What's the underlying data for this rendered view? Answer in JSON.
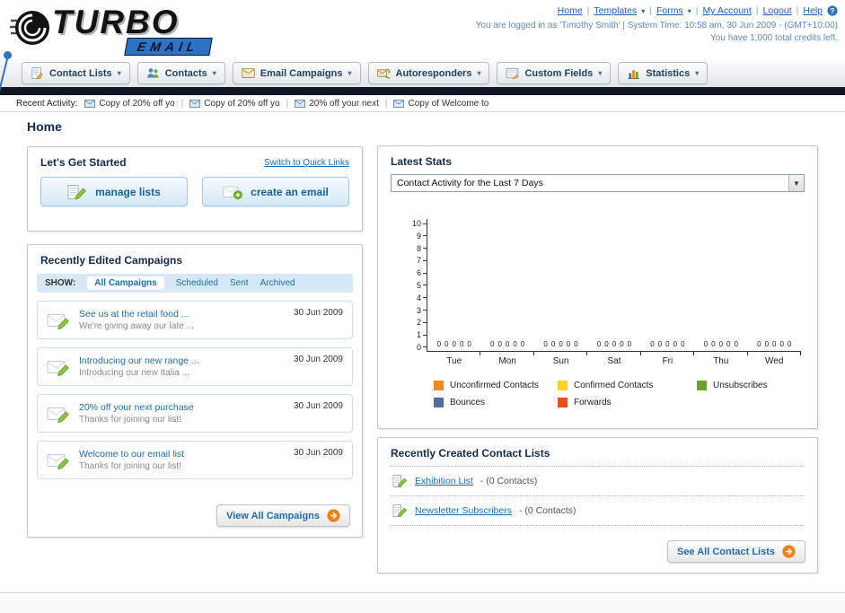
{
  "page_title": "Home",
  "header": {
    "logo_primary": "TURBO",
    "logo_secondary": "EMAIL",
    "nav_links": [
      {
        "label": "Home",
        "dropdown": false
      },
      {
        "label": "Templates",
        "dropdown": true
      },
      {
        "label": "Forms",
        "dropdown": true
      },
      {
        "label": "My Account",
        "dropdown": false
      },
      {
        "label": "Logout",
        "dropdown": false
      },
      {
        "label": "Help",
        "dropdown": false
      }
    ],
    "login_info": "You are logged in as 'Timothy Smith' | System Time: 10:58 am, 30 Jun 2009 - (GMT+10:00)",
    "credits": "You have 1,000 total credits left."
  },
  "nav": {
    "tabs": [
      {
        "label": "Contact Lists",
        "icon": "contact-lists-icon"
      },
      {
        "label": "Contacts",
        "icon": "contacts-icon"
      },
      {
        "label": "Email Campaigns",
        "icon": "email-campaigns-icon"
      },
      {
        "label": "Autoresponders",
        "icon": "autoresponders-icon"
      },
      {
        "label": "Custom Fields",
        "icon": "custom-fields-icon"
      },
      {
        "label": "Statistics",
        "icon": "statistics-icon"
      }
    ]
  },
  "recent_activity": {
    "label": "Recent Activity:",
    "items": [
      "Copy of 20% off yo",
      "Copy of 20% off yo",
      "20% off your next",
      "Copy of Welcome to"
    ]
  },
  "get_started": {
    "title": "Let's Get Started",
    "switch_link": "Switch to Quick Links",
    "buttons": [
      {
        "label": "manage lists",
        "icon": "manage-lists-icon"
      },
      {
        "label": "create an email",
        "icon": "create-email-icon"
      }
    ]
  },
  "campaigns": {
    "title": "Recently Edited Campaigns",
    "show_label": "SHOW:",
    "filters": [
      "All Campaigns",
      "Scheduled",
      "Sent",
      "Archived"
    ],
    "selected_index": 0,
    "items": [
      {
        "title": "See us at the retail food ...",
        "subtitle": "We're giving away our late ...",
        "date": "30 Jun 2009"
      },
      {
        "title": "Introducing our new range ...",
        "subtitle": "Introducing our new Italia ...",
        "date": "30 Jun 2009"
      },
      {
        "title": "20% off your next purchase",
        "subtitle": "Thanks for joining our list!",
        "date": "30 Jun 2009"
      },
      {
        "title": "Welcome to our email list",
        "subtitle": "Thanks for joining our list!",
        "date": "30 Jun 2009"
      }
    ],
    "view_all": "View All Campaigns"
  },
  "stats": {
    "title": "Latest Stats",
    "dropdown_value": "Contact Activity for the Last 7 Days",
    "chart_data": {
      "type": "bar",
      "title": "Contact Activity for the Last 7 Days",
      "categories": [
        "Tue",
        "Mon",
        "Sun",
        "Sat",
        "Fri",
        "Thu",
        "Wed"
      ],
      "series": [
        {
          "name": "Unconfirmed Contacts",
          "color": "#f0891f",
          "values": [
            0,
            0,
            0,
            0,
            0,
            0,
            0
          ]
        },
        {
          "name": "Confirmed Contacts",
          "color": "#fdd21f",
          "values": [
            0,
            0,
            0,
            0,
            0,
            0,
            0
          ]
        },
        {
          "name": "Unsubscribes",
          "color": "#69a32a",
          "values": [
            0,
            0,
            0,
            0,
            0,
            0,
            0
          ]
        },
        {
          "name": "Bounces",
          "color": "#4f6d9f",
          "values": [
            0,
            0,
            0,
            0,
            0,
            0,
            0
          ]
        },
        {
          "name": "Forwards",
          "color": "#e84e25",
          "values": [
            0,
            0,
            0,
            0,
            0,
            0,
            0
          ]
        }
      ],
      "ylim": [
        0,
        10
      ],
      "yticks": [
        10,
        9,
        8,
        7,
        6,
        5,
        4,
        3,
        2,
        1,
        0
      ],
      "grid": false,
      "legend_position": "bottom"
    }
  },
  "contact_lists": {
    "title": "Recently Created Contact Lists",
    "items": [
      {
        "name": "Exhibition List",
        "detail": "(0 Contacts)"
      },
      {
        "name": "Newsletter Subscribers",
        "detail": "(0 Contacts)"
      }
    ],
    "see_all": "See All Contact Lists"
  }
}
